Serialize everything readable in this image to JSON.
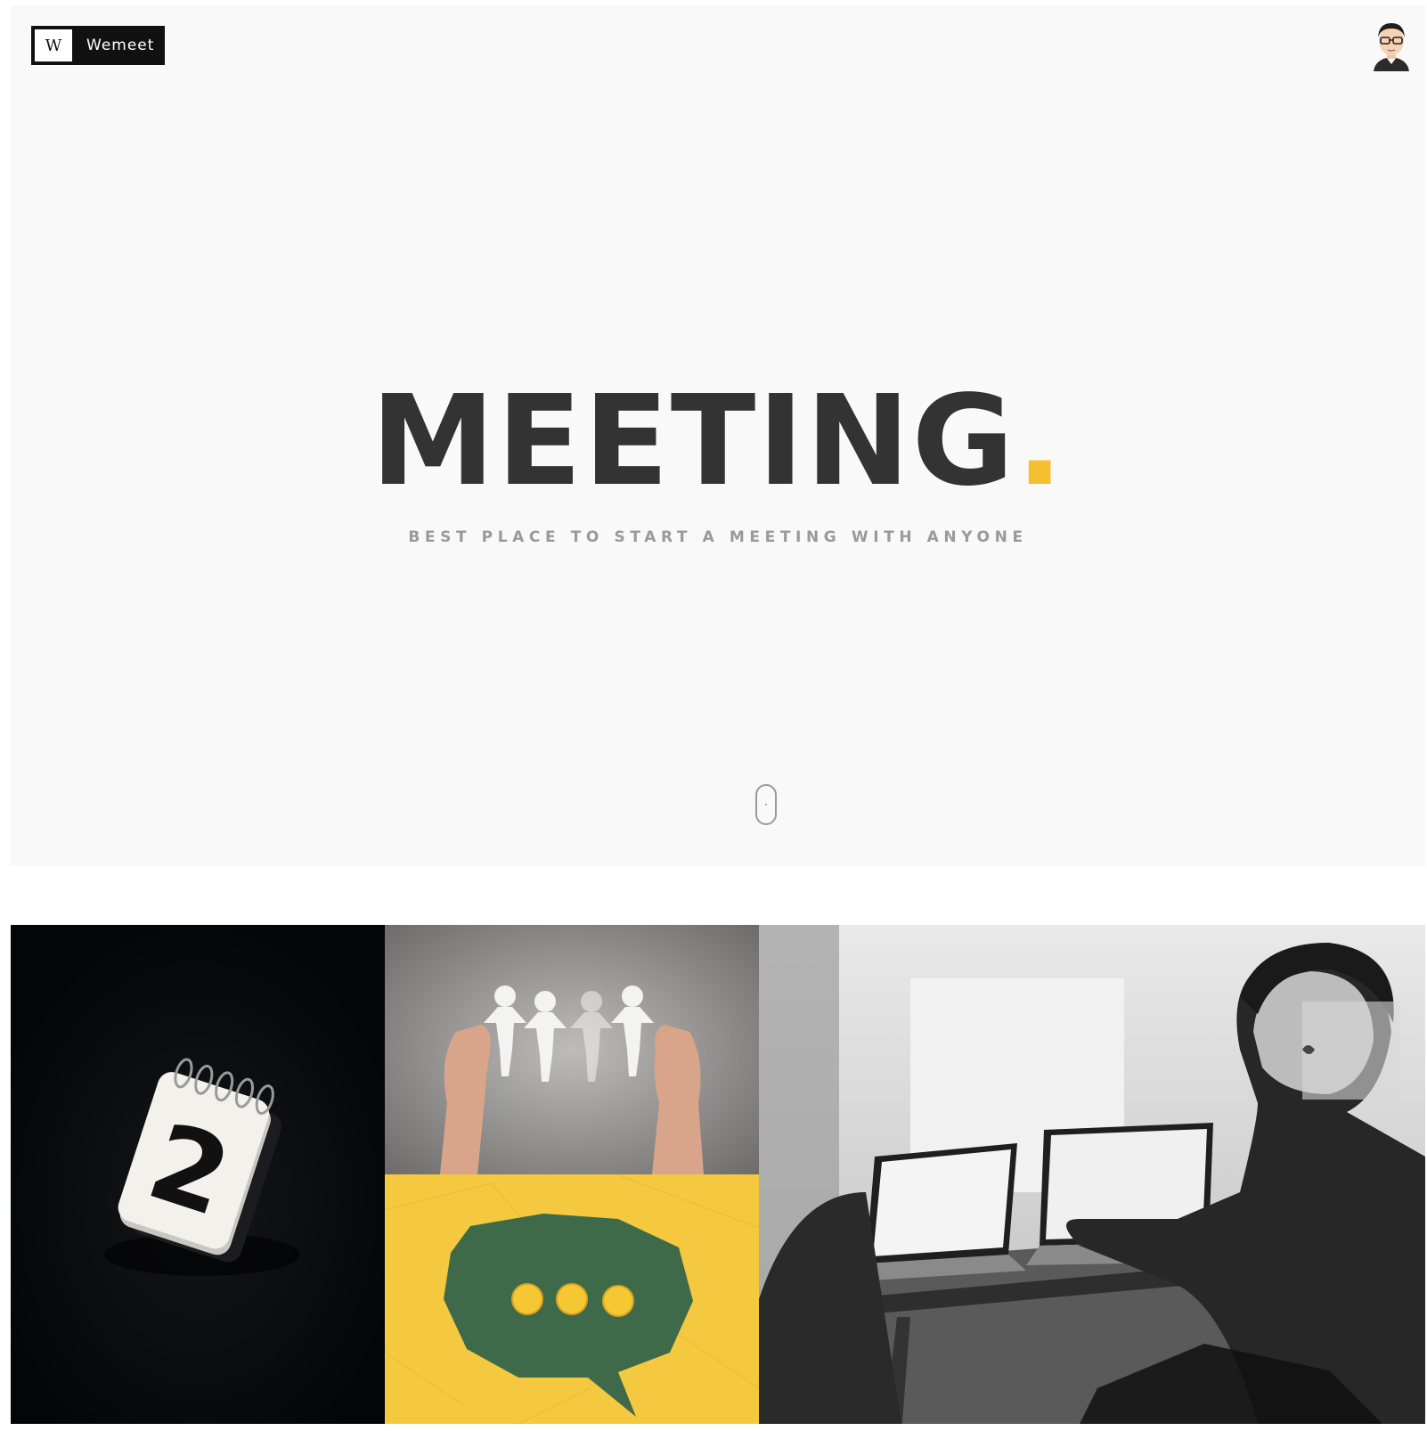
{
  "header": {
    "logo_mark": "W",
    "logo_text": "Wemeet",
    "avatar_icon": "user-avatar-icon"
  },
  "hero": {
    "title": "MEETING",
    "title_dot": ".",
    "subtitle": "BEST PLACE TO START A MEETING WITH ANYONE",
    "scroll_icon": "mouse-scroll-icon"
  },
  "colors": {
    "accent": "#f5c02f",
    "title": "#333333",
    "subtitle": "#9a9a9a",
    "hero_bg": "#f9f9f9"
  },
  "gallery": {
    "images": [
      "calendar-number-2-image",
      "paper-people-chain-image",
      "speech-bubble-paper-balls-image",
      "people-working-laptops-image"
    ]
  }
}
